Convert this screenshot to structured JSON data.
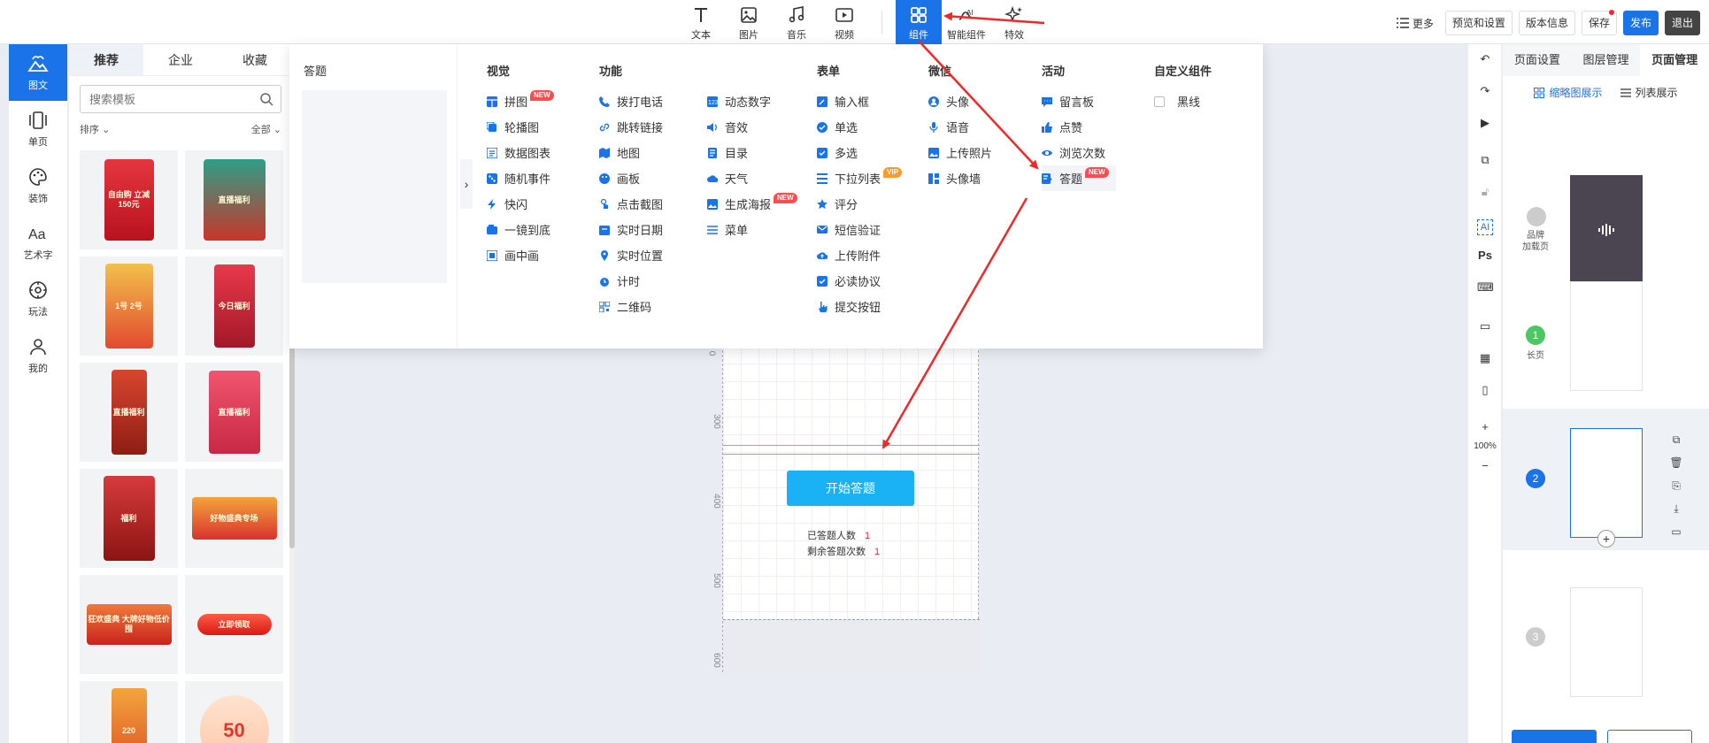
{
  "toolbar": {
    "tools": [
      {
        "label": "文本",
        "icon": "text-icon"
      },
      {
        "label": "图片",
        "icon": "image-icon"
      },
      {
        "label": "音乐",
        "icon": "music-icon"
      },
      {
        "label": "视频",
        "icon": "video-icon"
      },
      {
        "label": "组件",
        "icon": "components-icon",
        "active": true
      },
      {
        "label": "智能组件",
        "icon": "smart-component-icon"
      },
      {
        "label": "特效",
        "icon": "sparkle-icon"
      }
    ],
    "more": "更多",
    "buttons": [
      "预览和设置",
      "版本信息",
      "保存",
      "发布",
      "退出"
    ]
  },
  "leftnav": [
    {
      "label": "图文",
      "icon": "picture-text-icon",
      "active": true
    },
    {
      "label": "单页",
      "icon": "single-page-icon"
    },
    {
      "label": "装饰",
      "icon": "palette-icon"
    },
    {
      "label": "艺术字",
      "icon": "art-text-icon"
    },
    {
      "label": "玩法",
      "icon": "gameplay-icon"
    },
    {
      "label": "我的",
      "icon": "user-icon"
    }
  ],
  "templates": {
    "tabs": [
      "推荐",
      "企业",
      "收藏"
    ],
    "active_tab": "推荐",
    "search_placeholder": "搜索模板",
    "sort_label": "排序",
    "filter_label": "全部",
    "posters": [
      "自由购\n立减150元",
      "直播福利",
      "1号\n2号",
      "今日福利",
      "直播福利",
      "直播福利",
      "福利",
      "好物盛典专场",
      "狂欢盛典\n大牌好物低价囤",
      "立即领取",
      "220",
      "50"
    ]
  },
  "menu": {
    "left_title": "答题",
    "columns": [
      {
        "title": "视觉",
        "items": [
          {
            "label": "拼图",
            "badge": "NEW"
          },
          {
            "label": "轮播图"
          },
          {
            "label": "数据图表"
          },
          {
            "label": "随机事件"
          },
          {
            "label": "快闪"
          },
          {
            "label": "一镜到底"
          },
          {
            "label": "画中画"
          }
        ]
      },
      {
        "title": "功能",
        "items": [
          {
            "label": "拨打电话"
          },
          {
            "label": "跳转链接"
          },
          {
            "label": "地图"
          },
          {
            "label": "画板"
          },
          {
            "label": "点击截图"
          },
          {
            "label": "实时日期"
          },
          {
            "label": "实时位置"
          },
          {
            "label": "计时"
          },
          {
            "label": "二维码"
          }
        ]
      },
      {
        "title": "",
        "items": [
          {
            "label": "动态数字"
          },
          {
            "label": "音效"
          },
          {
            "label": "目录"
          },
          {
            "label": "天气"
          },
          {
            "label": "生成海报",
            "badge": "NEW"
          },
          {
            "label": "菜单"
          }
        ]
      },
      {
        "title": "表单",
        "items": [
          {
            "label": "输入框"
          },
          {
            "label": "单选"
          },
          {
            "label": "多选"
          },
          {
            "label": "下拉列表",
            "badge": "VIP"
          },
          {
            "label": "评分"
          },
          {
            "label": "短信验证"
          },
          {
            "label": "上传附件"
          },
          {
            "label": "必读协议"
          },
          {
            "label": "提交按钮"
          }
        ]
      },
      {
        "title": "微信",
        "items": [
          {
            "label": "头像"
          },
          {
            "label": "语音"
          },
          {
            "label": "上传照片"
          },
          {
            "label": "头像墙"
          }
        ]
      },
      {
        "title": "活动",
        "items": [
          {
            "label": "留言板"
          },
          {
            "label": "点赞"
          },
          {
            "label": "浏览次数"
          },
          {
            "label": "答题",
            "badge": "NEW",
            "highlight": true
          }
        ]
      },
      {
        "title": "自定义组件",
        "items": [
          {
            "label": "黑线"
          }
        ]
      }
    ]
  },
  "canvas": {
    "ruler": [
      "0",
      "300",
      "400",
      "500",
      "600"
    ],
    "start_button": "开始答题",
    "stats": [
      {
        "label": "已答题人数",
        "value": "1"
      },
      {
        "label": "剩余答题次数",
        "value": "1"
      }
    ]
  },
  "rightstrip": {
    "zoom": "100%",
    "ai": "AI",
    "ps": "Ps"
  },
  "rightpanel": {
    "tabs": [
      "页面设置",
      "图层管理",
      "页面管理"
    ],
    "active_tab": "页面管理",
    "views": [
      "缩略图展示",
      "列表展示"
    ],
    "pages": [
      {
        "label": "品牌\n加载页"
      },
      {
        "num": "1",
        "label": "长页"
      },
      {
        "num": "2"
      },
      {
        "num": "3"
      }
    ]
  },
  "colors": {
    "accent": "#1a73e8",
    "arrow": "#f02828",
    "badge": "#ff4d4f"
  }
}
